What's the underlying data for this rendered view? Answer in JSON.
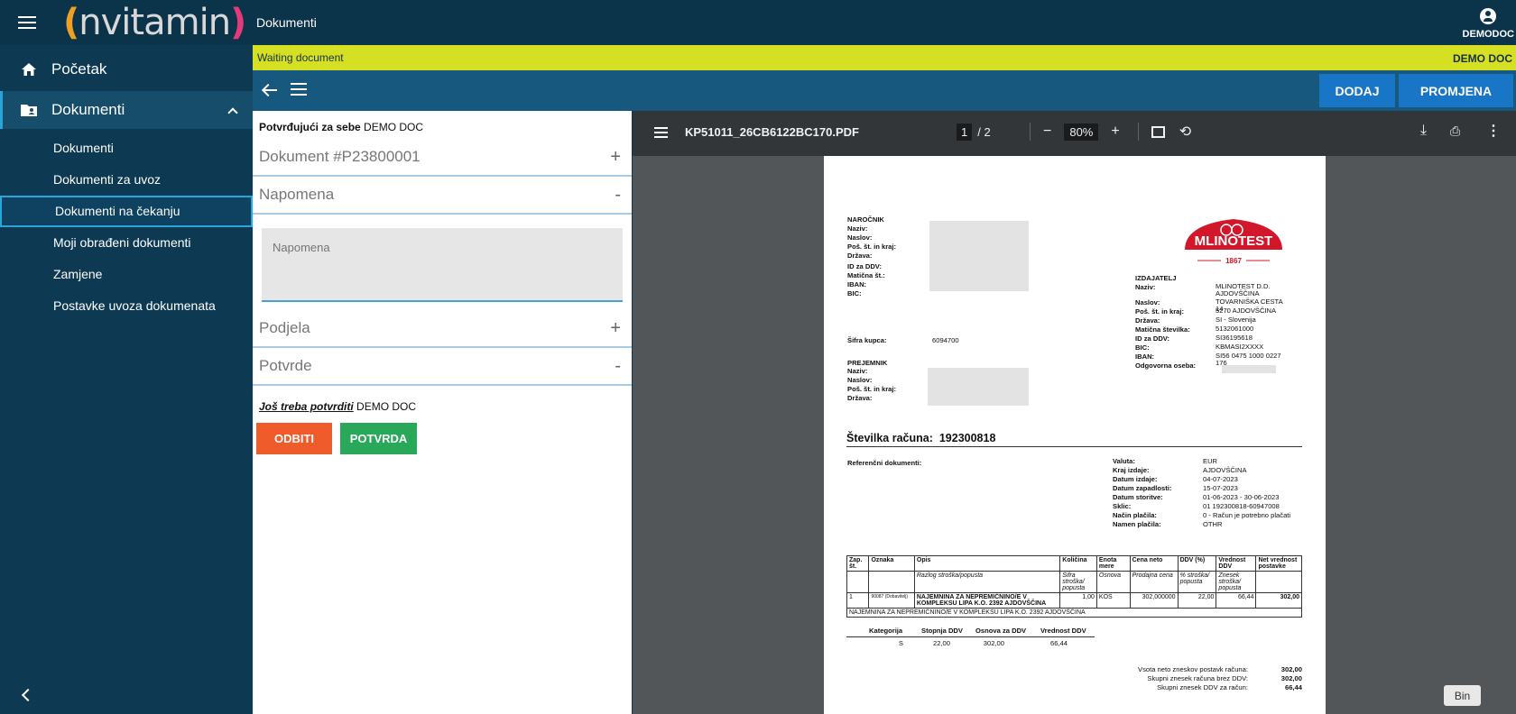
{
  "brand": {
    "logo_text": "nvitamin",
    "logo_left": "(",
    "logo_right": ")"
  },
  "sidebar": {
    "home_label": "Početak",
    "docs_label": "Dokumenti",
    "items": [
      {
        "label": "Dokumenti"
      },
      {
        "label": "Dokumenti za uvoz"
      },
      {
        "label": "Dokumenti na čekanju"
      },
      {
        "label": "Moji obrađeni dokumenti"
      },
      {
        "label": "Zamjene"
      },
      {
        "label": "Postavke uvoza dokumenata"
      }
    ]
  },
  "header": {
    "title": "Dokumenti",
    "user": "DEMODOC"
  },
  "status": {
    "text": "Waiting document",
    "org": "DEMO DOC"
  },
  "toolbar": {
    "add_label": "DODAJ",
    "change_label": "PROMJENA"
  },
  "panel": {
    "confirm_label": "Potvrđujući za sebe",
    "confirm_value": "DEMO DOC",
    "document_title": "Dokument #P23800001",
    "note_title": "Napomena",
    "note_placeholder": "Napomena",
    "split_title": "Podjela",
    "confirmations_title": "Potvrde",
    "pending_label": "Još treba potvrditi",
    "pending_value": "DEMO DOC",
    "reject_label": "ODBITI",
    "confirm_button": "POTVRDA",
    "plus": "+",
    "minus": "-"
  },
  "viewer": {
    "filename": "KP51011_26CB6122BC170.PDF",
    "page": "1",
    "pages": "/ 2",
    "zoom": "80%"
  },
  "invoice": {
    "buyer_header": "NAROČNIK",
    "buyer_fields": [
      "Naziv:",
      "Naslov:",
      "Poš. št. in kraj:",
      "Država:",
      "ID za DDV:",
      "Matična št.:",
      "IBAN:",
      "BIC:"
    ],
    "customer_code_label": "Šifra kupca:",
    "customer_code": "6094700",
    "recipient_header": "PREJEMNIK",
    "recipient_fields": [
      "Naziv:",
      "Naslov:",
      "Poš. št. in kraj:",
      "Država:"
    ],
    "logo_text": "MLINOTEST",
    "logo_year": "1867",
    "issuer_header": "IZDAJATELJ",
    "issuer": [
      {
        "k": "Naziv:",
        "v": "MLINOTEST D.D. AJDOVŠČINA"
      },
      {
        "k": "Naslov:",
        "v": "TOVARNIŠKA CESTA 14"
      },
      {
        "k": "Poš. št. in kraj:",
        "v": "5270 AJDOVŠČINA"
      },
      {
        "k": "Država:",
        "v": "SI - Slovenija"
      },
      {
        "k": "Matična številka:",
        "v": "5132061000"
      },
      {
        "k": "ID za DDV:",
        "v": "SI36195618"
      },
      {
        "k": "BIC:",
        "v": "KBMASI2XXXX"
      },
      {
        "k": "IBAN:",
        "v": "SI56 0475 1000 0227 176"
      },
      {
        "k": "Odgovorna oseba:",
        "v": ""
      }
    ],
    "invoice_label": "Številka računa:",
    "invoice_number": "192300818",
    "ref_label": "Referenčni dokumenti:",
    "meta": [
      {
        "k": "Valuta:",
        "v": "EUR"
      },
      {
        "k": "Kraj izdaje:",
        "v": "AJDOVŠČINA"
      },
      {
        "k": "Datum izdaje:",
        "v": "04-07-2023"
      },
      {
        "k": "Datum zapadlosti:",
        "v": "15-07-2023"
      },
      {
        "k": "Datum storitve:",
        "v": "01-06-2023 - 30-06-2023"
      },
      {
        "k": "Sklic:",
        "v": "01 192300818-60947008"
      },
      {
        "k": "Način plačila:",
        "v": "0 - Račun je potrebno plačati"
      },
      {
        "k": "Namen plačila:",
        "v": "OTHR"
      }
    ],
    "table_head": [
      "Zap. št.",
      "Oznaka",
      "Opis",
      "Količina",
      "Enota mere",
      "Cena neto",
      "DDV (%)",
      "Vrednost DDV",
      "Net vrednost postavke"
    ],
    "table_sub": [
      "",
      "",
      "Razlog stroška/popusta",
      "Šifra stroška/ popusta",
      "Osnova",
      "Prodajna cena",
      "% stroška/ popusta",
      "Znesek stroška/ popusta",
      ""
    ],
    "row": [
      "1",
      "90087 (Dobavitelj)",
      "NAJEMNINA ZA NEPREMIČNINO/E V KOMPLEKSU LIPA K.O. 2392 AJDOVŠČINA",
      "1,00",
      "KOS",
      "302,000000",
      "22,00",
      "66,44",
      "302,00"
    ],
    "row_note": "NAJEMNINA ZA NEPREMIČNINO/E V KOMPLEKSU LIPA K.O. 2392 AJDOVŠČINA",
    "vat_head": [
      "Kategorija",
      "Stopnja DDV",
      "Osnova za DDV",
      "Vrednost DDV"
    ],
    "vat_row": [
      "S",
      "22,00",
      "302,00",
      "66,44"
    ],
    "totals": [
      {
        "k": "Vsota neto zneskov postavk računa:",
        "v": "302,00"
      },
      {
        "k": "Skupni znesek računa brez DDV:",
        "v": "302,00"
      },
      {
        "k": "Skupni znesek DDV za račun:",
        "v": "66,44"
      }
    ]
  },
  "tooltip": {
    "text": "Bin"
  },
  "colors": {
    "sidebar": "#0d3a52",
    "status": "#d6e023",
    "toolbar": "#17587f",
    "primary": "#1976c7",
    "reject": "#ef5b2a",
    "confirm": "#2aa85a"
  }
}
